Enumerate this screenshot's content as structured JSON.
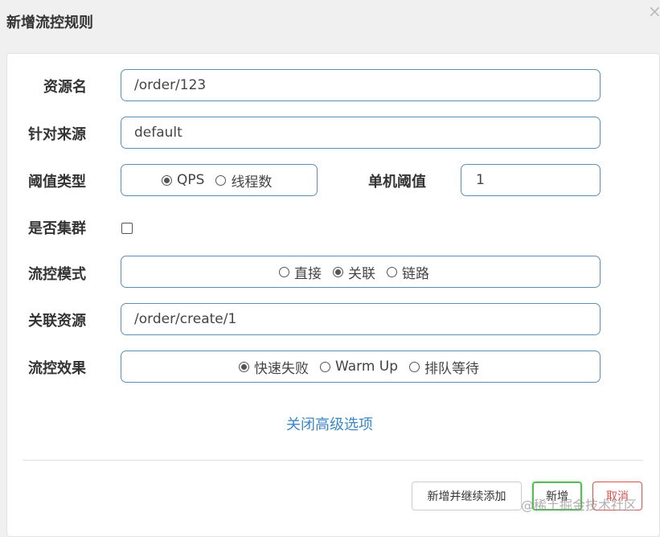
{
  "dialog": {
    "title": "新增流控规则"
  },
  "form": {
    "resource": {
      "label": "资源名",
      "value": "/order/123"
    },
    "source": {
      "label": "针对来源",
      "value": "default"
    },
    "threshold_type": {
      "label": "阈值类型",
      "options": [
        "QPS",
        "线程数"
      ],
      "selected": "QPS"
    },
    "single_threshold": {
      "label": "单机阈值",
      "value": "1"
    },
    "cluster": {
      "label": "是否集群",
      "checked": false
    },
    "mode": {
      "label": "流控模式",
      "options": [
        "直接",
        "关联",
        "链路"
      ],
      "selected": "关联"
    },
    "related_resource": {
      "label": "关联资源",
      "value": "/order/create/1"
    },
    "effect": {
      "label": "流控效果",
      "options": [
        "快速失败",
        "Warm Up",
        "排队等待"
      ],
      "selected": "快速失败"
    }
  },
  "advanced_link": "关闭高级选项",
  "buttons": {
    "add_continue": "新增并继续添加",
    "add": "新增",
    "cancel": "取消"
  },
  "watermark": "@稀土掘金技术社区",
  "colors": {
    "input_border": "#5b8fb9",
    "link": "#3c87c8",
    "add_border": "#5cb85c",
    "cancel": "#d9534f"
  }
}
